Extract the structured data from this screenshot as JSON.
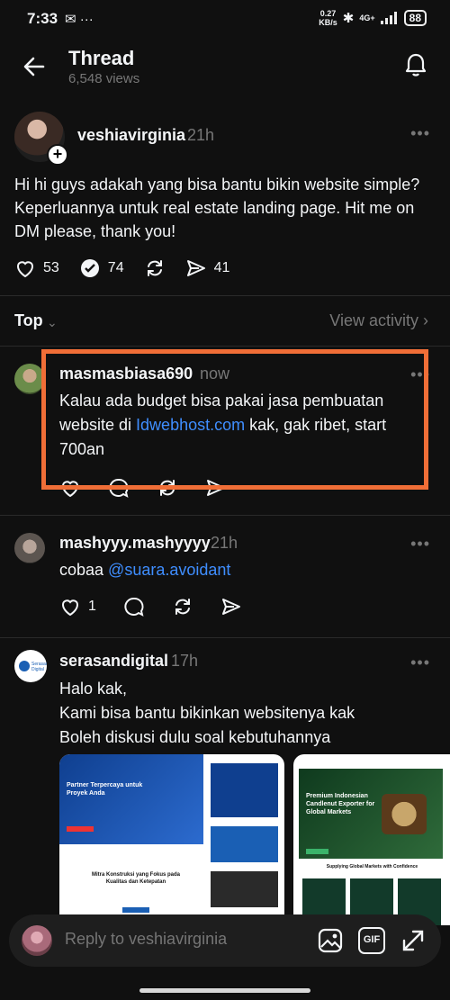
{
  "status": {
    "time": "7:33",
    "net_speed": "0.27",
    "net_unit": "KB/s",
    "network": "4G+",
    "battery": "88"
  },
  "header": {
    "title": "Thread",
    "views": "6,548 views"
  },
  "post": {
    "author": "veshiavirginia",
    "time": "21h",
    "text": "Hi hi guys adakah yang bisa bantu bikin website simple? Keperluannya untuk real estate landing page. Hit me on DM please, thank you!",
    "likes": "53",
    "comments": "74",
    "shares": "41"
  },
  "sort": {
    "label": "Top",
    "view_activity": "View activity"
  },
  "replies": [
    {
      "author": "masmasbiasa690",
      "time": "now",
      "text_before": "Kalau ada budget bisa pakai jasa pembuatan website di ",
      "link": "Idwebhost.com",
      "text_after": " kak, gak ribet, start 700an"
    },
    {
      "author": "mashyyy.mashyyyy",
      "time": "21h",
      "text_before": "cobaa ",
      "link": "@suara.avoidant",
      "likes": "1"
    },
    {
      "author": "serasandigital",
      "time": "17h",
      "lines": [
        "Halo kak,",
        "Kami bisa bantu bikinkan websitenya kak",
        "Boleh diskusi dulu soal kebutuhannya"
      ],
      "avatar_text": "Serasan Digital"
    }
  ],
  "cards": [
    {
      "hero_title": "Partner Terpercaya untuk Proyek Anda",
      "section_title": "Mitra Konstruksi yang Fokus pada Kualitas dan Ketepatan"
    },
    {
      "hero_title": "Premium Indonesian Candlenut Exporter for Global Markets",
      "section_title": "Supplying Global Markets with Confidence"
    }
  ],
  "reply_bar": {
    "placeholder": "Reply to veshiavirginia",
    "gif_label": "GIF"
  },
  "colors": {
    "background": "#101010",
    "link": "#3f8eff",
    "highlight": "#f06e37"
  }
}
